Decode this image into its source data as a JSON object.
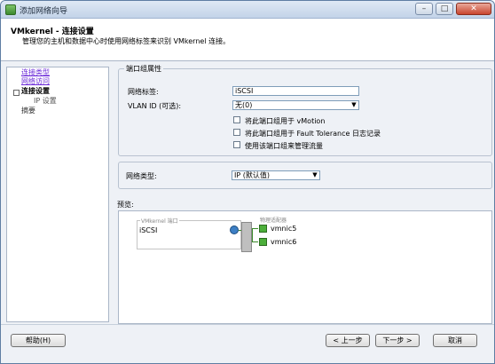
{
  "window": {
    "title": "添加网络向导",
    "controls": {
      "minimize": "–",
      "maximize": "□",
      "close": "✕"
    }
  },
  "header": {
    "title": "VMkernel - 连接设置",
    "subtitle": "管理您的主机和数据中心时使用网络标签来识别 VMkernel 连接。"
  },
  "nav": {
    "items": [
      {
        "label": "连接类型"
      },
      {
        "label": "网络访问"
      },
      {
        "label": "连接设置"
      },
      {
        "label": "IP 设置"
      },
      {
        "label": "摘要"
      }
    ],
    "expander": "⊟"
  },
  "port_group": {
    "legend": "端口组属性",
    "network_label_label": "网络标签:",
    "network_label_value": "iSCSI",
    "vlan_label": "VLAN ID (可选):",
    "vlan_value": "无(0)",
    "checkboxes": [
      {
        "label": "将此端口组用于 vMotion",
        "checked": false
      },
      {
        "label": "将此端口组用于 Fault Tolerance 日志记录",
        "checked": false
      },
      {
        "label": "使用该端口组来管理流量",
        "checked": false
      }
    ]
  },
  "network_type": {
    "label": "网络类型:",
    "value": "IP (默认值)"
  },
  "preview": {
    "label": "预览:",
    "vmkernel_caption": "VMkernel 端口",
    "port_name": "iSCSI",
    "adapters_caption": "物理适配器",
    "adapters": [
      "vmnic5",
      "vmnic6"
    ]
  },
  "footer": {
    "help": "帮助(H)",
    "back": "< 上一步",
    "next": "下一步 >",
    "cancel": "取消"
  },
  "colors": {
    "link": "#6c2bd9",
    "adapter_green": "#4caf3a",
    "switch_gray": "#bfbfbf"
  }
}
